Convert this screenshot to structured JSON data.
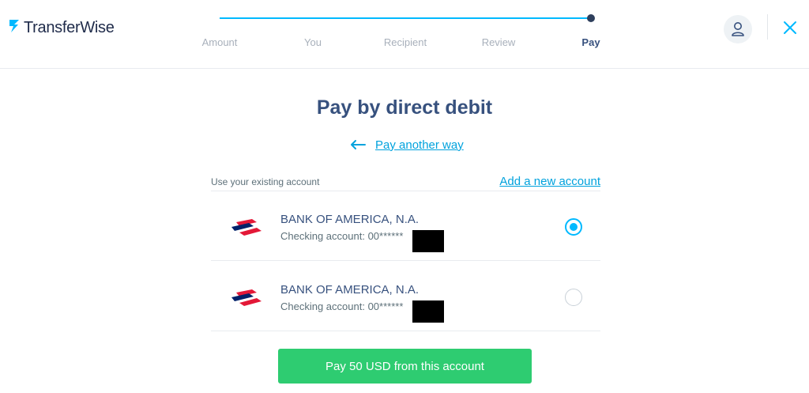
{
  "header": {
    "logo_text": "TransferWise",
    "steps": [
      {
        "label": "Amount"
      },
      {
        "label": "You"
      },
      {
        "label": "Recipient"
      },
      {
        "label": "Review"
      },
      {
        "label": "Pay"
      }
    ],
    "active_step": "Pay",
    "avatar_icon": "user-icon",
    "close_icon": "close-icon"
  },
  "main": {
    "title": "Pay by direct debit",
    "alt_link": "Pay another way",
    "section_label": "Use your existing account",
    "add_account": "Add a new account",
    "accounts": [
      {
        "bank": "BANK OF AMERICA, N.A.",
        "detail": "Checking account: 00******",
        "selected": true
      },
      {
        "bank": "BANK OF AMERICA, N.A.",
        "detail": "Checking account: 00******",
        "selected": false
      }
    ],
    "pay_button": "Pay 50 USD from this account"
  },
  "colors": {
    "accent": "#00b9ff",
    "link": "#00a2dd",
    "text": "#37517e",
    "pay_green": "#2ecc71",
    "boa_red": "#e31837",
    "boa_blue": "#012169"
  }
}
